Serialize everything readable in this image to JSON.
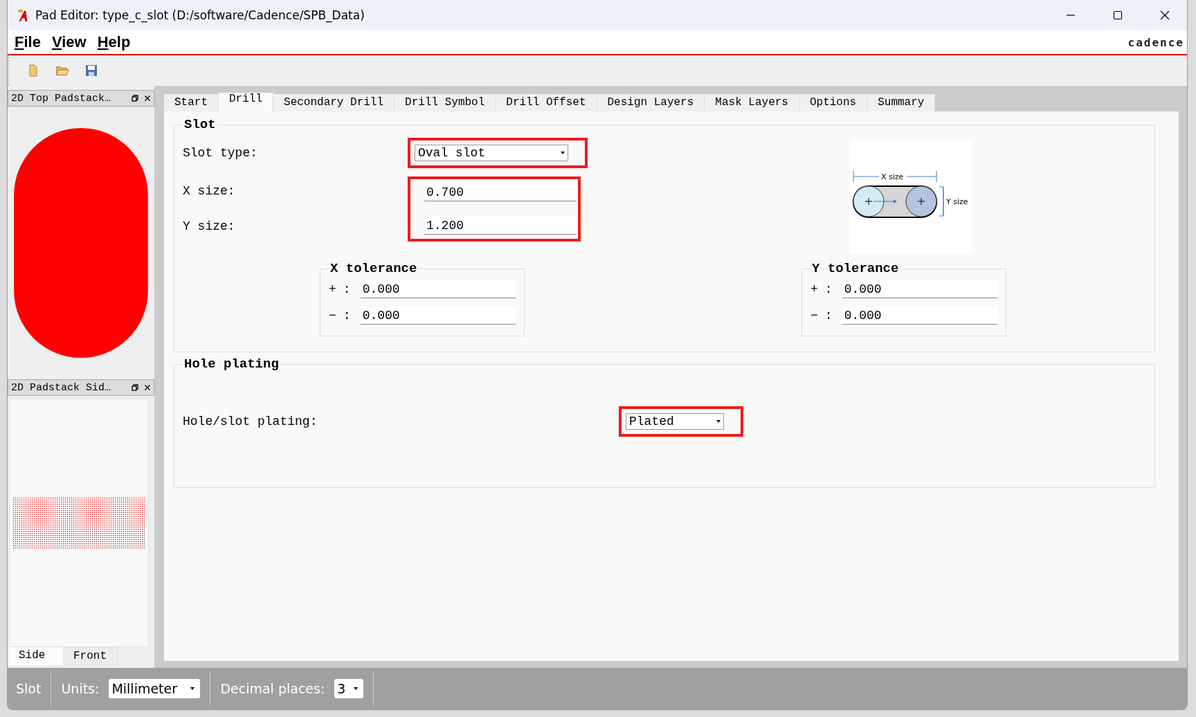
{
  "window": {
    "title": "Pad Editor: type_c_slot  (D:/software/Cadence/SPB_Data)",
    "brand": "cadence"
  },
  "menu": [
    {
      "label": "File"
    },
    {
      "label": "View"
    },
    {
      "label": "Help"
    }
  ],
  "top_panel": {
    "title": "2D Top Padstack…"
  },
  "side_panel": {
    "title": "2D Padstack Sid…",
    "tabs": [
      {
        "label": "Side",
        "selected": true
      },
      {
        "label": "Front",
        "selected": false
      }
    ]
  },
  "tabs": [
    {
      "label": "Start",
      "selected": false
    },
    {
      "label": "Drill",
      "selected": true
    },
    {
      "label": "Secondary Drill",
      "selected": false
    },
    {
      "label": "Drill Symbol",
      "selected": false
    },
    {
      "label": "Drill Offset",
      "selected": false
    },
    {
      "label": "Design Layers",
      "selected": false
    },
    {
      "label": "Mask Layers",
      "selected": false
    },
    {
      "label": "Options",
      "selected": false
    },
    {
      "label": "Summary",
      "selected": false
    }
  ],
  "slot": {
    "title": "Slot",
    "slot_type": {
      "label": "Slot type:",
      "value": "Oval slot",
      "highlighted": true
    },
    "sizes_highlighted": true,
    "x_size": {
      "label": "X size:",
      "value": "0.700"
    },
    "y_size": {
      "label": "Y size:",
      "value": "1.200"
    },
    "diagram": {
      "x_label": "X size",
      "y_label": "Y size"
    },
    "tolerances": [
      {
        "title": "X tolerance",
        "rows": [
          {
            "sign": "+",
            "colon": ":",
            "value": "0.000"
          },
          {
            "sign": "−",
            "colon": ":",
            "value": "0.000"
          }
        ]
      },
      {
        "title": "Y tolerance",
        "rows": [
          {
            "sign": "+",
            "colon": ":",
            "value": "0.000"
          },
          {
            "sign": "−",
            "colon": ":",
            "value": "0.000"
          }
        ]
      }
    ]
  },
  "hole_plating": {
    "title": "Hole plating",
    "label": "Hole/slot plating:",
    "value": "Plated",
    "highlighted": true
  },
  "status_bar": {
    "mode": "Slot",
    "units_label": "Units:",
    "units": "Millimeter",
    "decimal_label": "Decimal places:",
    "decimal": "3"
  }
}
